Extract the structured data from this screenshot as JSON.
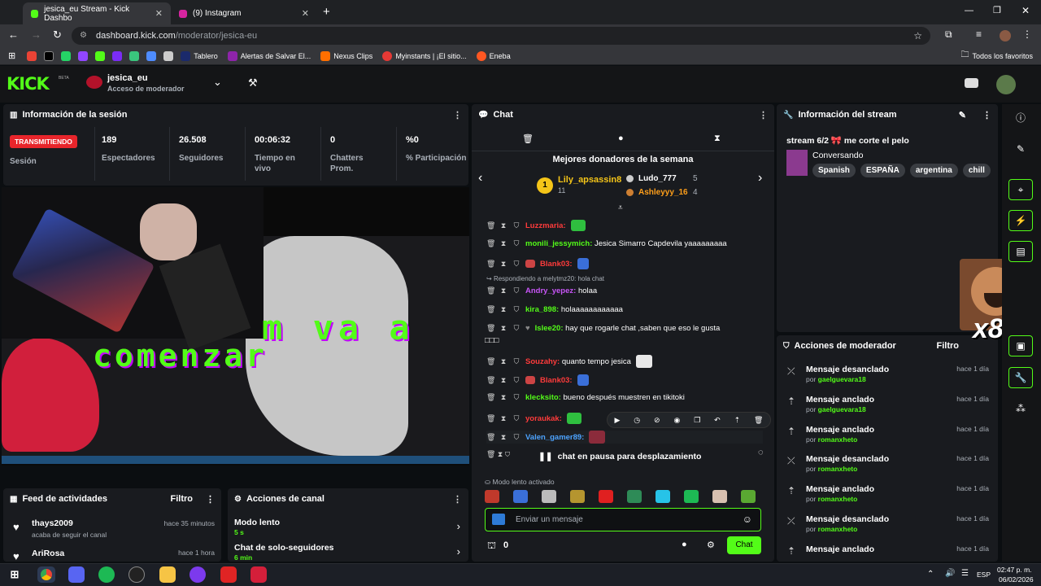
{
  "browser": {
    "tabs": [
      {
        "title": "jesica_eu Stream - Kick Dashbo"
      },
      {
        "title": "(9) Instagram"
      }
    ],
    "url_host": "dashboard.kick.com",
    "url_path": "/moderator/jesica-eu",
    "bookmarks": [
      "Tablero",
      "Alertas de Salvar El...",
      "Nexus Clips",
      "Myinstants | ¡El sitio...",
      "Eneba"
    ],
    "all_bookmarks": "Todos los favoritos"
  },
  "header": {
    "logo": "KICK",
    "logo_beta": "BETA",
    "channel": "jesica_eu",
    "role": "Acceso de moderador"
  },
  "session": {
    "title": "Información de la sesión",
    "badge": "TRANSMITIENDO",
    "badge_sub": "Sesión",
    "stats": [
      {
        "value": "189",
        "label": "Espectadores"
      },
      {
        "value": "26.508",
        "label": "Seguidores"
      },
      {
        "value": "00:06:32",
        "label": "Tiempo en vivo"
      },
      {
        "value": "0",
        "label": "Chatters Prom."
      },
      {
        "value": "%0",
        "label": "% Participación"
      }
    ]
  },
  "stream_overlay_text": {
    "line1": "m va a",
    "line2": "comenzar"
  },
  "activity": {
    "title": "Feed de actividades",
    "filter": "Filtro",
    "items": [
      {
        "user": "thays2009",
        "action": "acaba de seguir el canal",
        "time": "hace 35 minutos"
      },
      {
        "user": "AriRosa",
        "time": "hace 1 hora"
      }
    ]
  },
  "channel_actions": {
    "title": "Acciones de canal",
    "items": [
      {
        "label": "Modo lento",
        "value": "5 s"
      },
      {
        "label": "Chat de solo-seguidores",
        "value": "6 min"
      }
    ]
  },
  "chat": {
    "title": "Chat",
    "top_donors_title": "Mejores donadores de la semana",
    "donors": [
      {
        "rank": "1",
        "name": "Lily_apsassin8",
        "amount": "11"
      },
      {
        "name": "Ludo_777",
        "amount": "5"
      },
      {
        "name": "Ashleyyy_16",
        "amount": "4"
      }
    ],
    "reply_note": "Respondiendo a melytmz20: hola chat",
    "messages": [
      {
        "user": "Luzzmaria:",
        "text": "",
        "color": "#ff3b3b"
      },
      {
        "user": "monili_jessymich:",
        "text": "Jesica Simarro Capdevila yaaaaaaaaa",
        "color": "#53fc18"
      },
      {
        "user": "Blank03:",
        "text": "",
        "color": "#ff3b3b"
      },
      {
        "user": "Andry_yepez:",
        "text": "holaa",
        "color": "#c855f7"
      },
      {
        "user": "kira_898:",
        "text": "holaaaaaaaaaaaa",
        "color": "#53fc18"
      },
      {
        "user": "Islee20:",
        "text": "hay que rogarle chat ,saben que eso le gusta",
        "color": "#53fc18"
      },
      {
        "user": "Souzahy:",
        "text": "quanto tempo jesica",
        "color": "#ff3b3b"
      },
      {
        "user": "Blank03:",
        "text": "",
        "color": "#ff3b3b"
      },
      {
        "user": "klecksito:",
        "text": "bueno después muestren en tikitoki",
        "color": "#53fc18"
      },
      {
        "user": "yoraukak:",
        "text": "",
        "color": "#ff3b3b"
      },
      {
        "user": "Valen_gamer89:",
        "text": "",
        "color": "#4da3ff"
      }
    ],
    "wrap_glyphs": "□□□",
    "paused": "chat en pausa para desplazamiento",
    "slow_mode": "Modo lento activado",
    "input_placeholder": "Enviar un mensaje",
    "points": "0",
    "send_label": "Chat"
  },
  "stream_info": {
    "title": "Información del stream",
    "stream_title": "stream 6/2 🎀 me corte el pelo",
    "category": "Conversando",
    "tags": [
      "Spanish",
      "ESPAÑA",
      "argentina",
      "chill"
    ]
  },
  "mod_actions": {
    "title": "Acciones de moderador",
    "filter": "Filtro",
    "by_prefix": "por",
    "items": [
      {
        "action": "Mensaje desanclado",
        "by": "gaelguevara18",
        "time": "hace 1 día"
      },
      {
        "action": "Mensaje anclado",
        "by": "gaelguevara18",
        "time": "hace 1 día"
      },
      {
        "action": "Mensaje anclado",
        "by": "romanxheto",
        "time": "hace 1 día"
      },
      {
        "action": "Mensaje desanclado",
        "by": "romanxheto",
        "time": "hace 1 día"
      },
      {
        "action": "Mensaje anclado",
        "by": "romanxheto",
        "time": "hace 1 día"
      },
      {
        "action": "Mensaje desanclado",
        "by": "romanxheto",
        "time": "hace 1 día"
      },
      {
        "action": "Mensaje anclado",
        "by": "romanxheto",
        "time": "hace 1 día"
      }
    ]
  },
  "overlay_badge": "x8",
  "taskbar": {
    "lang": "ESP",
    "time": "02:47 p. m.",
    "date": "06/02/2026"
  },
  "colors": {
    "kick_green": "#53fc18",
    "panel": "#191b1f",
    "live_red": "#e8252b"
  }
}
